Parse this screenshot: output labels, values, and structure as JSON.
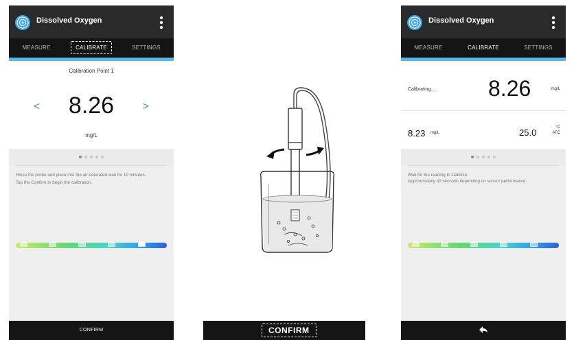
{
  "left_phone": {
    "title": "Dissolved Oxygen",
    "tabs": [
      "MEASURE",
      "CALIBRATE",
      "SETTINGS"
    ],
    "active_tab": "CALIBRATE",
    "calibration_point": "Calibration Point 1",
    "prev": "<",
    "value": "8.26",
    "next": ">",
    "unit": "mg/L",
    "instructions": [
      "Rinse the probe and place into the air-saturated wait for 10 minutes.",
      "Tap the Confirm to begin the calibration."
    ],
    "bottom_label": "CONFIRM"
  },
  "center": {
    "confirm_label": "CONFIRM"
  },
  "right_phone": {
    "title": "Dissolved Oxygen",
    "tabs": [
      "MEASURE",
      "CALIBRATE",
      "SETTINGS"
    ],
    "active_tab": "CALIBRATE",
    "status": "Calibrating...",
    "value": "8.26",
    "unit": "mg/L",
    "reading": "8.23",
    "reading_unit": "mg/L",
    "temperature": "25.0",
    "temp_unit": "°C",
    "temp_mode": "ATC",
    "instructions": [
      "Wait for the reading to stabilize.",
      "Approximately 30 seconds depending on sensor performance."
    ],
    "back_icon": "back-arrow-icon"
  },
  "colors": {
    "accent": "#5ab7e6",
    "appbar": "#2a2a2a",
    "tabbar": "#141414"
  }
}
